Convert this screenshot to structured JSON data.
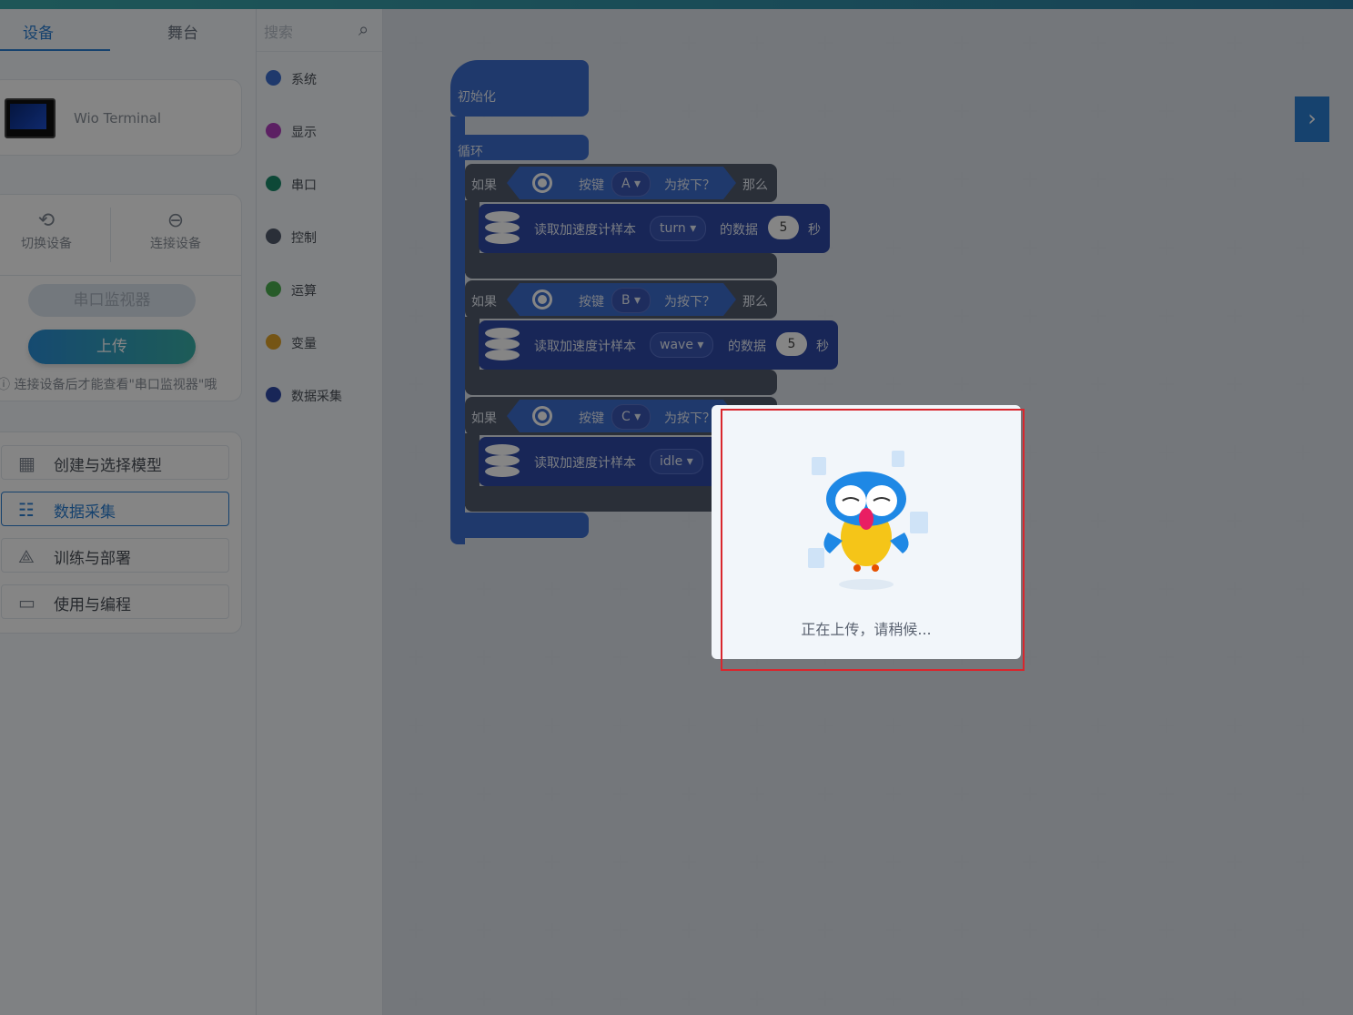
{
  "tabs": {
    "device": "设备",
    "stage": "舞台"
  },
  "device": {
    "name": "Wio Terminal"
  },
  "actions": {
    "switch": "切换设备",
    "connect": "连接设备",
    "serial_monitor": "串口监视器",
    "upload": "上传",
    "hint": "连接设备后才能查看\"串口监视器\"哦"
  },
  "menu": [
    {
      "label": "创建与选择模型",
      "icon": "grid-plus-icon",
      "active": false
    },
    {
      "label": "数据采集",
      "icon": "data-list-icon",
      "active": true
    },
    {
      "label": "训练与部署",
      "icon": "network-icon",
      "active": false
    },
    {
      "label": "使用与编程",
      "icon": "terminal-icon",
      "active": false
    }
  ],
  "search": {
    "placeholder": "搜索"
  },
  "categories": [
    {
      "label": "系统",
      "color": "#3d6dcf"
    },
    {
      "label": "显示",
      "color": "#b03fbf"
    },
    {
      "label": "串口",
      "color": "#1a8a6a"
    },
    {
      "label": "控制",
      "color": "#525a6b"
    },
    {
      "label": "运算",
      "color": "#4caf50"
    },
    {
      "label": "变量",
      "color": "#e0a32a"
    },
    {
      "label": "数据采集",
      "color": "#2f49a8"
    }
  ],
  "blocks": {
    "init": "初始化",
    "loop": "循环",
    "if": "如果",
    "button": "按键",
    "pressed": "为按下？",
    "then": "那么",
    "read": "读取加速度计样本",
    "data_of": "的数据",
    "seconds": "秒",
    "rows": [
      {
        "key": "A",
        "sample": "turn",
        "secs": "5"
      },
      {
        "key": "B",
        "sample": "wave",
        "secs": "5"
      },
      {
        "key": "C",
        "sample": "idle",
        "secs": ""
      }
    ],
    "pressed_short": "为按下"
  },
  "dialog": {
    "message": "正在上传，请稍候..."
  }
}
